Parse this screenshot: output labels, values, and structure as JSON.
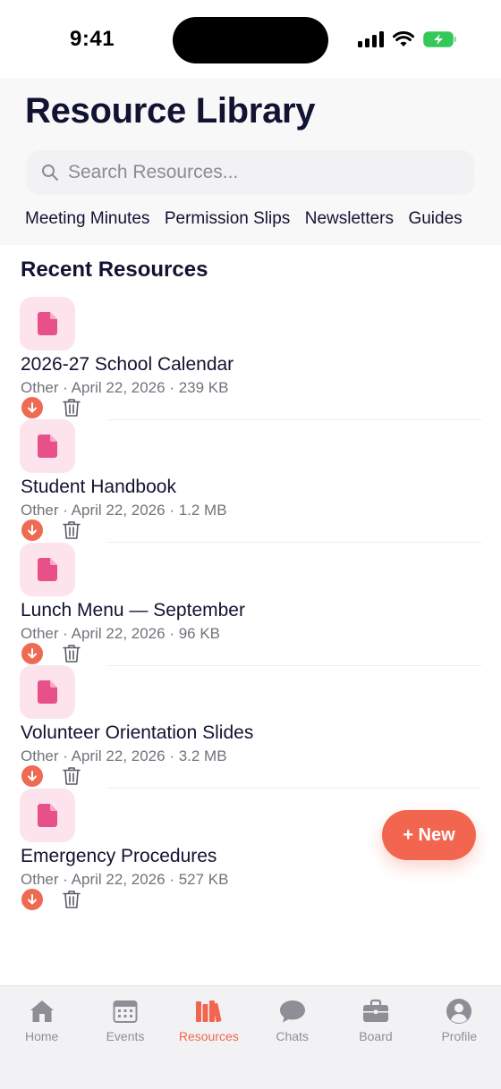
{
  "status_bar": {
    "time": "9:41"
  },
  "header": {
    "title": "Resource Library",
    "search_placeholder": "Search Resources...",
    "categories": [
      "Meeting Minutes",
      "Permission Slips",
      "Newsletters",
      "Guides"
    ]
  },
  "section": {
    "title": "Recent Resources"
  },
  "resources": [
    {
      "title": "2026-27 School Calendar",
      "meta": "Other · April 22, 2026 · 239 KB",
      "icon": "document-icon"
    },
    {
      "title": "Student Handbook",
      "meta": "Other · April 22, 2026 · 1.2 MB",
      "icon": "document-icon"
    },
    {
      "title": "Lunch Menu — September",
      "meta": "Other · April 22, 2026 · 96 KB",
      "icon": "document-icon"
    },
    {
      "title": "Volunteer Orientation Slides",
      "meta": "Other · April 22, 2026 · 3.2 MB",
      "icon": "document-icon"
    },
    {
      "title": "Emergency Procedures",
      "meta": "Other · April 22, 2026 · 527 KB",
      "icon": "document-icon"
    }
  ],
  "fab": {
    "label": "+ New"
  },
  "tab_bar": {
    "items": [
      {
        "label": "Home",
        "icon": "house-icon",
        "active": false
      },
      {
        "label": "Events",
        "icon": "calendar-icon",
        "active": false
      },
      {
        "label": "Resources",
        "icon": "books-icon",
        "active": true
      },
      {
        "label": "Chats",
        "icon": "chat-bubble-icon",
        "active": false
      },
      {
        "label": "Board",
        "icon": "briefcase-icon",
        "active": false
      },
      {
        "label": "Profile",
        "icon": "person-icon",
        "active": false
      }
    ]
  },
  "colors": {
    "accent": "#f26650",
    "file_icon": "#e8508a",
    "file_badge_bg": "#fde3ec",
    "title_text": "#121232",
    "muted_text": "#72727c",
    "tab_inactive": "#8e8e96",
    "battery": "#34c759"
  }
}
